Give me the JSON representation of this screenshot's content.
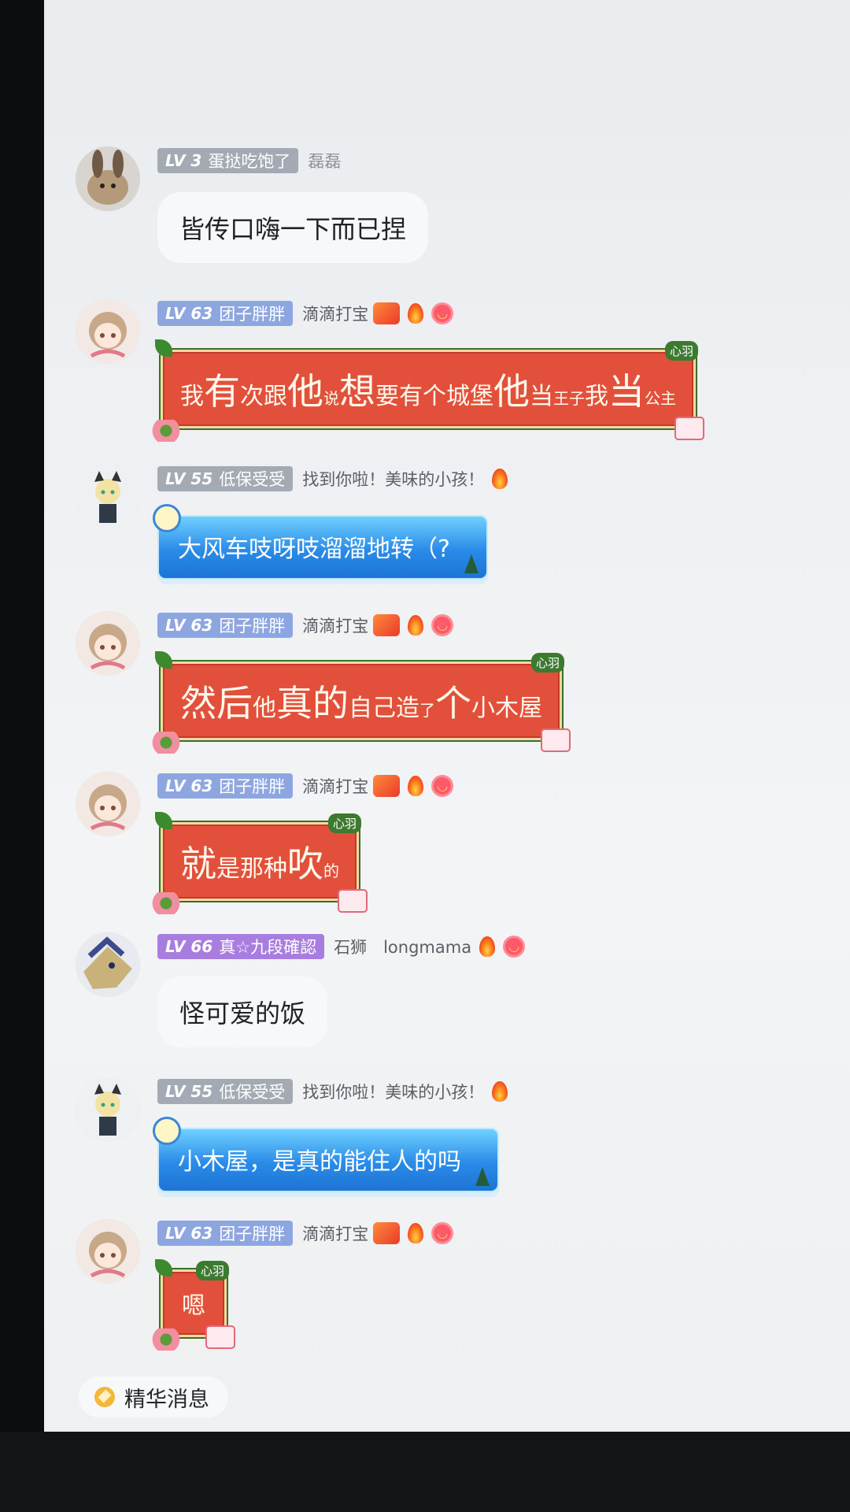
{
  "messages": [
    {
      "level": "LV 3",
      "title": "蛋挞吃饱了",
      "nick": "磊磊",
      "text": "皆传口嗨一下而已捏"
    },
    {
      "level": "LV 63",
      "title": "团子胖胖",
      "nick": "滴滴打宝",
      "tag": "心羽",
      "segments": [
        [
          "我",
          "mid"
        ],
        [
          "有",
          "big"
        ],
        [
          "次跟",
          "mid"
        ],
        [
          "他",
          "big"
        ],
        [
          "说",
          "sm"
        ],
        [
          "想",
          "big"
        ],
        [
          "要有个城堡",
          "mid"
        ],
        [
          "他",
          "big"
        ],
        [
          "当",
          "mid"
        ],
        [
          "王子",
          "sm"
        ],
        [
          "我",
          "mid"
        ],
        [
          "当",
          "big"
        ],
        [
          "公主",
          "sm"
        ]
      ]
    },
    {
      "level": "LV 55",
      "title": "低保受受",
      "nick": "找到你啦！美味的小孩！",
      "text": "大风车吱呀吱溜溜地转（?"
    },
    {
      "level": "LV 63",
      "title": "团子胖胖",
      "nick": "滴滴打宝",
      "tag": "心羽",
      "segments": [
        [
          "然后",
          "big"
        ],
        [
          "他",
          "mid"
        ],
        [
          "真的",
          "big"
        ],
        [
          "自己造",
          "mid"
        ],
        [
          "了",
          "sm"
        ],
        [
          "个",
          "big"
        ],
        [
          "小木屋",
          "mid"
        ]
      ]
    },
    {
      "level": "LV 63",
      "title": "团子胖胖",
      "nick": "滴滴打宝",
      "tag": "心羽",
      "segments": [
        [
          "就",
          "big"
        ],
        [
          "是那种",
          "mid"
        ],
        [
          "吹",
          "big"
        ],
        [
          "的",
          "sm"
        ]
      ]
    },
    {
      "level": "LV 66",
      "title": "真☆九段確認",
      "nick": "石狮　longmama",
      "text": "怪可爱的饭"
    },
    {
      "level": "LV 55",
      "title": "低保受受",
      "nick": "找到你啦！美味的小孩！",
      "text": "小木屋，是真的能住人的吗"
    },
    {
      "level": "LV 63",
      "title": "团子胖胖",
      "nick": "滴滴打宝",
      "tag": "心羽",
      "segments": [
        [
          "嗯",
          "mid"
        ]
      ]
    }
  ],
  "essence_label": "精华消息",
  "colors": {
    "red_bubble": "#e2503b",
    "blue_bubble": "#2a8be8",
    "lv_gray": "#a3aab4",
    "lv_blue": "#8ea6e0",
    "lv_purple": "#a97ddf"
  }
}
